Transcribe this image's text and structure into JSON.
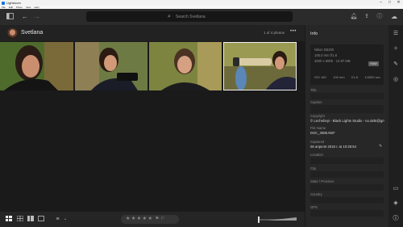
{
  "window": {
    "title": "Lightroom",
    "controls": [
      "–",
      "□",
      "✕"
    ]
  },
  "menu": [
    "File",
    "Edit",
    "Photo",
    "View",
    "Help"
  ],
  "toolbar": {
    "search_placeholder": "Search Svetlana",
    "icons": [
      "sidebar-toggle",
      "back-arrow",
      "forward-arrow",
      "filter",
      "notifications",
      "share",
      "help",
      "cloud"
    ]
  },
  "album": {
    "title": "Svetlana",
    "count": "1 of 4 photos",
    "more": "•••"
  },
  "thumbnails": [
    {
      "name": "photo-1",
      "selected": false
    },
    {
      "name": "photo-2",
      "selected": false
    },
    {
      "name": "photo-3",
      "selected": false
    },
    {
      "name": "photo-4",
      "selected": true
    }
  ],
  "info": {
    "title": "Info",
    "camera": "Nikon D5200",
    "lens": "105.0 mm f/1.8",
    "dimensions": "4000 x 6000 · 12.97 MB",
    "raw_badge": "RAW",
    "exif": {
      "iso": "ISO 160",
      "focal": "105 mm",
      "aperture": "f/1.8",
      "shutter": "1/4000 sec"
    },
    "fields": {
      "title_label": "Title",
      "caption_label": "Caption",
      "copyright_label": "Copyright",
      "copyright_value": "© Lechebnyi - Black Lights Studio - no.debt@gmail.com",
      "filename_label": "File Name",
      "filename_value": "DSC_3085.NEF",
      "captured_label": "Captured",
      "captured_value": "06 апреля 2019 г. at 10:28:54",
      "location_label": "Location",
      "city_label": "City",
      "state_label": "State / Province",
      "country_label": "Country",
      "gps_label": "GPS"
    }
  },
  "bottombar": {
    "views": [
      "grid-view",
      "square-grid-view",
      "detail-view",
      "single-view"
    ],
    "sort_label": "≡",
    "stars": [
      "★",
      "★",
      "★",
      "★",
      "★"
    ],
    "flags": [
      "⚑",
      "⚐"
    ]
  },
  "rail": [
    "edit-sliders",
    "auto-enhance",
    "brush",
    "healing",
    "comments",
    "tags",
    "info"
  ],
  "colors": {
    "accent": "#1473e6",
    "panel": "#272727",
    "background": "#1a1a1a"
  }
}
